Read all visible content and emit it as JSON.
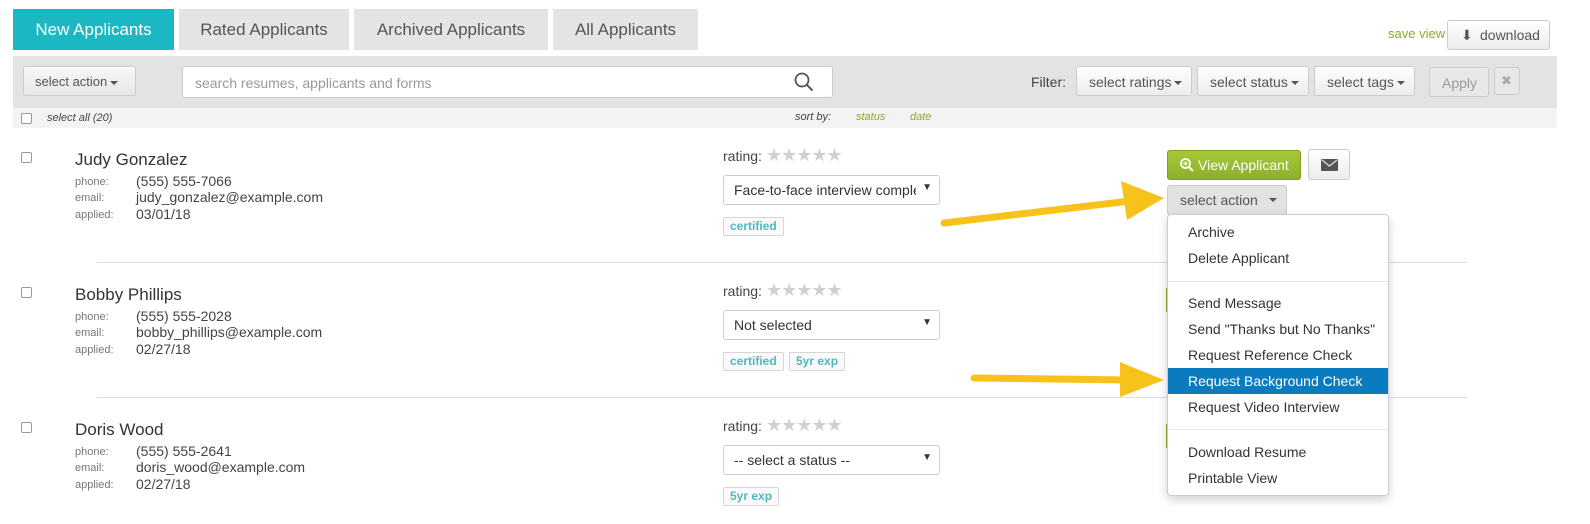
{
  "tabs": [
    "New Applicants",
    "Rated Applicants",
    "Archived Applicants",
    "All Applicants"
  ],
  "header": {
    "save_view": "save view",
    "download": "download"
  },
  "toolbar": {
    "select_action": "select action",
    "search_placeholder": "search resumes, applicants and forms",
    "filter_label": "Filter:",
    "ratings": "select ratings",
    "status": "select status",
    "tags": "select tags",
    "apply": "Apply",
    "clear_icon": "✖"
  },
  "subbar": {
    "select_all": "select all (20)",
    "sort_by": "sort by:",
    "sort_status": "status",
    "sort_date": "date"
  },
  "labels": {
    "phone": "phone:",
    "email": "email:",
    "applied": "applied:",
    "rating": "rating:"
  },
  "stars": "★★★★★",
  "applicants": [
    {
      "name": "Judy Gonzalez",
      "phone": "(555) 555-7066",
      "email": "judy_gonzalez@example.com",
      "applied": "03/01/18",
      "status": "Face-to-face interview completed",
      "tags": [
        "certified"
      ]
    },
    {
      "name": "Bobby Phillips",
      "phone": "(555) 555-2028",
      "email": "bobby_phillips@example.com",
      "applied": "02/27/18",
      "status": "Not selected",
      "tags": [
        "certified",
        "5yr exp"
      ]
    },
    {
      "name": "Doris Wood",
      "phone": "(555) 555-2641",
      "email": "doris_wood@example.com",
      "applied": "02/27/18",
      "status": "-- select a status --",
      "tags": [
        "5yr exp"
      ]
    }
  ],
  "actions": {
    "view_applicant": "View Applicant",
    "select_action": "select action"
  },
  "menu": {
    "group1": [
      "Archive",
      "Delete Applicant"
    ],
    "group2": [
      "Send Message",
      "Send \"Thanks but No Thanks\"",
      "Request Reference Check",
      "Request Background Check",
      "Request Video Interview"
    ],
    "group3": [
      "Download Resume",
      "Printable View"
    ],
    "selected": "Request Background Check"
  },
  "colors": {
    "accent": "#1bb8c4",
    "green": "#8bb02a",
    "menu_highlight": "#0b7bc0",
    "arrow": "#f7c21c"
  },
  "icons": {
    "search": "search-icon",
    "download": "download-arrow-icon",
    "magnifier": "magnifier-plus-icon",
    "envelope": "envelope-icon"
  }
}
